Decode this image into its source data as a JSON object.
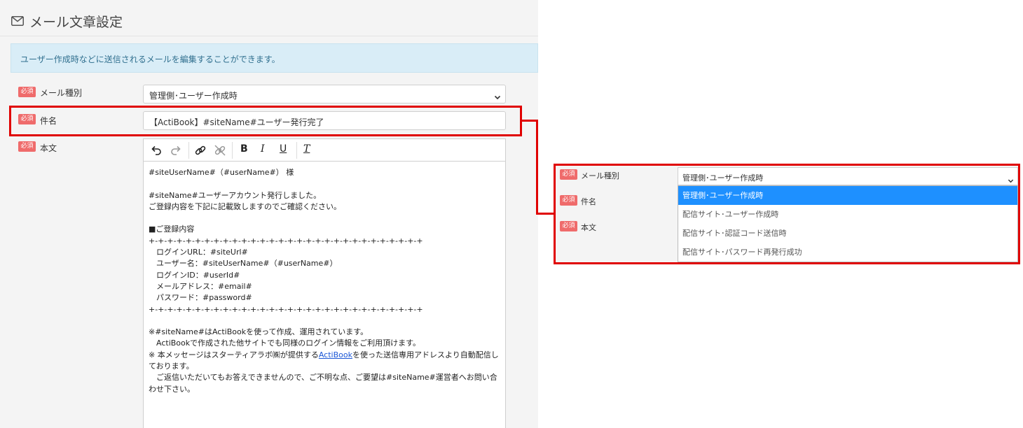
{
  "page": {
    "title": "メール文章設定",
    "info": "ユーザー作成時などに送信されるメールを編集することができます。"
  },
  "form": {
    "required_badge": "必須",
    "type_label": "メール種別",
    "type_value": "管理側･ユーザー作成時",
    "subject_label": "件名",
    "subject_value": "【ActiBook】#siteName#ユーザー発行完了",
    "body_label": "本文"
  },
  "toolbar": {
    "buttons": [
      "undo",
      "redo",
      "link",
      "unlink",
      "bold",
      "italic",
      "underline",
      "clear-format"
    ],
    "bold_label": "B",
    "italic_label": "I",
    "underline_label": "U",
    "clear_label": "T"
  },
  "body": {
    "text_before_link": "#siteUserName#（#userName#） 様\n\n#siteName#ユーザーアカウント発行しました。\nご登録内容を下記に記載致しますのでご確認ください。\n\n■ご登録内容\n+-+-+-+-+-+-+-+-+-+-+-+-+-+-+-+-+-+-+-+-+-+-+-+-+-+-+-+-+-+\n　ログインURL：#siteUrl#\n　ユーザー名：#siteUserName#（#userName#）\n　ログインID：#userId#\n　メールアドレス：#email#\n　パスワード：#password#\n+-+-+-+-+-+-+-+-+-+-+-+-+-+-+-+-+-+-+-+-+-+-+-+-+-+-+-+-+-+\n\n※#siteName#はActiBookを使って作成、運用されています。\n　ActiBookで作成された他サイトでも同様のログイン情報をご利用頂けます。\n※ 本メッセージはスターティアラボ㈱が提供する",
    "link_text": "ActiBook",
    "text_after_link": "を使った送信専用アドレスより自動配信しております。\n　ご返信いただいてもお答えできませんので、ご不明な点、ご要望は#siteName#運営者へお問い合わせ下さい。"
  },
  "dropdown": {
    "selected": "管理側･ユーザー作成時",
    "options": [
      "管理側･ユーザー作成時",
      "配信サイト･ユーザー作成時",
      "配信サイト･認証コード送信時",
      "配信サイト･パスワード再発行成功"
    ],
    "selected_index": 0,
    "highlight_color": "#1e90ff"
  },
  "colors": {
    "required_badge": "#ef6b6b",
    "highlight_frame": "#e00000",
    "info_bg": "#d9edf7",
    "info_text": "#31708f",
    "link": "#1a56d6"
  },
  "icons": [
    "envelope-icon",
    "chevron-down-icon"
  ]
}
